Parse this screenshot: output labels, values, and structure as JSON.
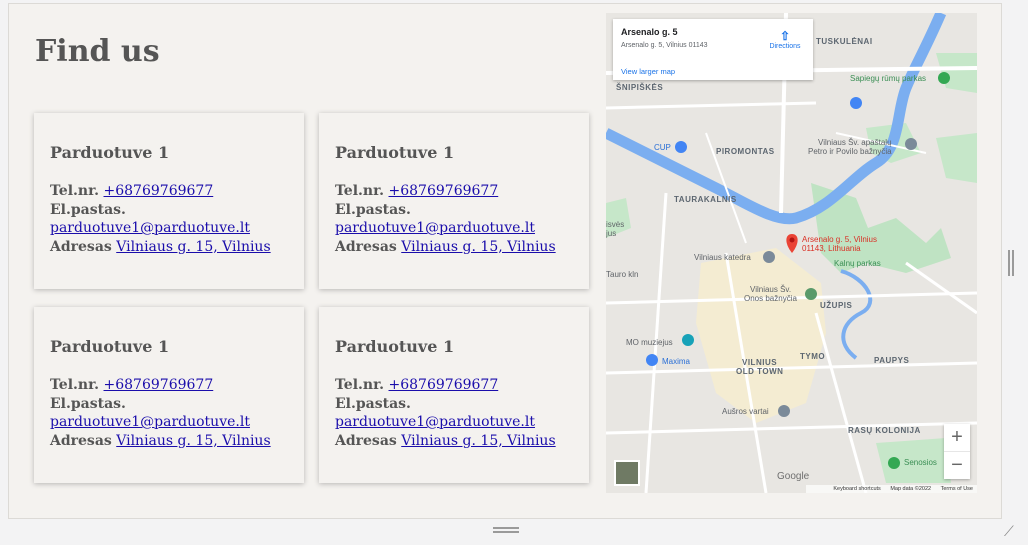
{
  "page": {
    "title": "Find us"
  },
  "stores": [
    {
      "name": "Parduotuve 1",
      "tel_label": "Tel.nr.",
      "tel": "+68769769677",
      "email_label": "El.pastas.",
      "email": "parduotuve1@parduotuve.lt",
      "address_label": "Adresas",
      "address": "Vilniaus g. 15, Vilnius"
    },
    {
      "name": "Parduotuve 1",
      "tel_label": "Tel.nr.",
      "tel": "+68769769677",
      "email_label": "El.pastas.",
      "email": "parduotuve1@parduotuve.lt",
      "address_label": "Adresas",
      "address": "Vilniaus g. 15, Vilnius"
    },
    {
      "name": "Parduotuve 1",
      "tel_label": "Tel.nr.",
      "tel": "+68769769677",
      "email_label": "El.pastas.",
      "email": "parduotuve1@parduotuve.lt",
      "address_label": "Adresas",
      "address": "Vilniaus g. 15, Vilnius"
    },
    {
      "name": "Parduotuve 1",
      "tel_label": "Tel.nr.",
      "tel": "+68769769677",
      "email_label": "El.pastas.",
      "email": "parduotuve1@parduotuve.lt",
      "address_label": "Adresas",
      "address": "Vilniaus g. 15, Vilnius"
    }
  ],
  "map": {
    "place_name": "Arsenalo g. 5",
    "place_address": "Arsenalo g. 5, Vilnius 01143",
    "directions": "Directions",
    "view_larger": "View larger map",
    "pin_label_1": "Arsenalo g. 5, Vilnius",
    "pin_label_2": "01143, Lithuania",
    "labels": {
      "tuskulenai": "TUSKULĖNAI",
      "sapiegu": "Sapiegų rūmų parkas",
      "snipiskes": "ŠNIPIŠKĖS",
      "cup": "CUP",
      "piromontas": "PIROMONTAS",
      "church1": "Vilniaus Šv. apaštalų",
      "church2": "Petro ir Povilo bažnyčia",
      "taurakalnis": "TAURAKALNIS",
      "katedra": "Vilniaus katedra",
      "kalnu": "Kalnų parkas",
      "onos1": "Vilniaus Šv.",
      "onos2": "Onos bažnyčia",
      "uzupis": "UŽUPIS",
      "mo": "MO muziejus",
      "maxima": "Maxima",
      "oldtown1": "VILNIUS",
      "oldtown2": "OLD TOWN",
      "tymo": "TYMO",
      "paupys": "PAUPYS",
      "ausros": "Aušros vartai",
      "rasu": "RASŲ KOLONIJA",
      "senosios": "Senosios",
      "tauro": "Tauro kln",
      "isves": "isvės",
      "jus": "jus"
    },
    "zoom_in": "+",
    "zoom_out": "−",
    "google": "Google",
    "keyboard": "Keyboard shortcuts",
    "map_data": "Map data ©2022",
    "terms": "Terms of Use"
  }
}
